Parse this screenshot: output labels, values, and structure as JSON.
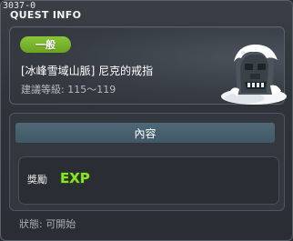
{
  "window": {
    "quest_id": "3037-0",
    "title": "QUEST INFO"
  },
  "quest": {
    "level_badge": "一般",
    "name": "[冰峰雪域山脈] 尼克的戒指",
    "recommended_level": "建議等級: 115～119"
  },
  "content": {
    "tab_label": "內容",
    "reward_label": "獎勵",
    "reward_icon": "exp-icon",
    "reward_icon_text": "EXP"
  },
  "status": {
    "text": "狀態: 可開始"
  },
  "colors": {
    "badge_green": "#7bb52c",
    "exp_green": "#8be22a"
  }
}
